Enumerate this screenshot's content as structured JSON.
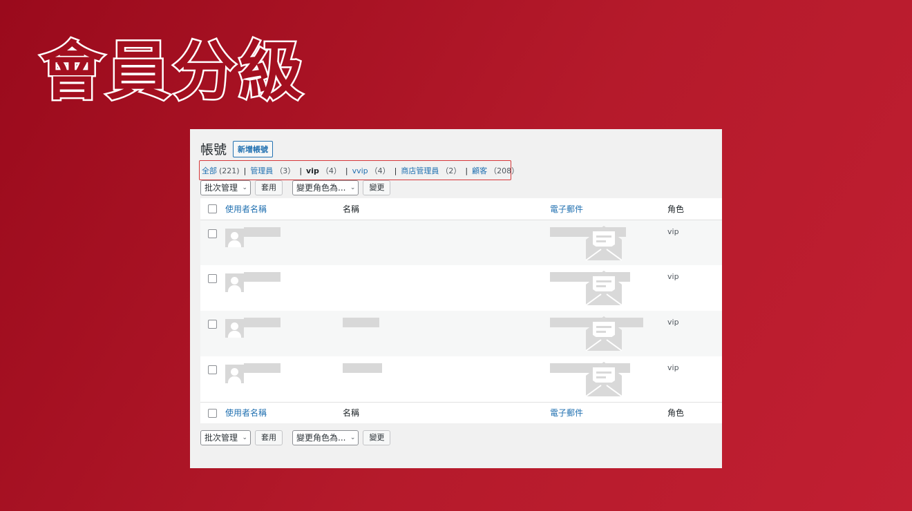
{
  "hero": {
    "title": "會員分級"
  },
  "panel": {
    "title": "帳號",
    "add_button": "新增帳號",
    "filters": [
      {
        "label": "全部",
        "count": "(221)",
        "current": false
      },
      {
        "label": "管理員",
        "count": "（3）",
        "current": false
      },
      {
        "label": "vip",
        "count": "（4）",
        "current": true
      },
      {
        "label": "vvip",
        "count": "（4）",
        "current": false
      },
      {
        "label": "商店管理員",
        "count": "（2）",
        "current": false
      },
      {
        "label": "顧客",
        "count": "（208）",
        "current": false
      }
    ],
    "bulk": {
      "bulk_select": "批次管理",
      "apply_button": "套用",
      "role_select": "變更角色為...",
      "change_button": "變更"
    },
    "columns": {
      "username": "使用者名稱",
      "name": "名稱",
      "email": "電子郵件",
      "role": "角色"
    },
    "rows": [
      {
        "role": "vip"
      },
      {
        "role": "vip"
      },
      {
        "role": "vip"
      },
      {
        "role": "vip"
      }
    ]
  },
  "colors": {
    "background": "#b51a2b",
    "link": "#2271b1",
    "highlight_border": "#d63638"
  },
  "icons": [
    "checkbox",
    "avatar-icon",
    "envelope-icon",
    "chevron-down-icon"
  ]
}
